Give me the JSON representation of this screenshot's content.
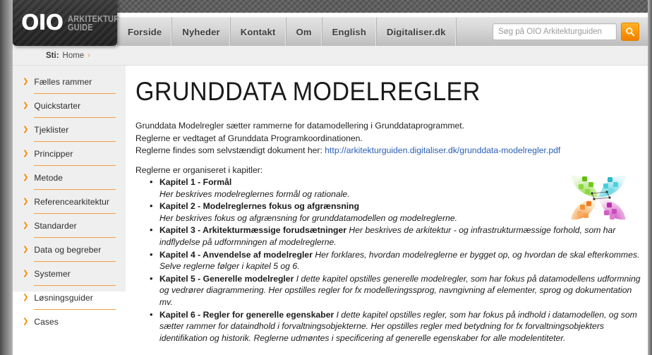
{
  "site": {
    "logo_main": "OIO",
    "logo_sub_line1": "ARKITEKTUR",
    "logo_sub_line2": "GUIDE",
    "accent_orange": "#f08c00",
    "link_blue": "#2b5fb5",
    "nav_bg": "#d5d5d5",
    "sidebar_bg": "#efefef"
  },
  "nav": {
    "items": [
      {
        "label": "Forside"
      },
      {
        "label": "Nyheder"
      },
      {
        "label": "Kontakt"
      },
      {
        "label": "Om"
      },
      {
        "label": "English"
      },
      {
        "label": "Digitaliser.dk"
      }
    ]
  },
  "search": {
    "placeholder": "Søg på OIO Arkitekturguiden",
    "value": "",
    "button_icon": "search-icon"
  },
  "breadcrumb": {
    "label": "Sti:",
    "home": "Home",
    "separator": "›"
  },
  "sidebar": {
    "items": [
      {
        "label": "Fælles rammer"
      },
      {
        "label": "Quickstarter"
      },
      {
        "label": "Tjeklister"
      },
      {
        "label": "Principper"
      },
      {
        "label": "Metode"
      },
      {
        "label": "Referencearkitektur"
      },
      {
        "label": "Standarder"
      },
      {
        "label": "Data og begreber"
      },
      {
        "label": "Systemer"
      },
      {
        "label": "Løsningsguider"
      },
      {
        "label": "Cases"
      }
    ]
  },
  "main": {
    "title": "GRUNDDATA MODELREGLER",
    "intro": {
      "line1": "Grunddata Modelregler sætter rammerne for datamodellering i Grunddataprogrammet.",
      "line2": "Reglerne er vedtaget af Grunddata Programkoordinationen.",
      "line3_prefix": "Reglerne findes som selvstændigt dokument her: ",
      "line3_link": "http://arkitekturguiden.digitaliser.dk/grunddata-modelregler.pdf",
      "line4": "Reglerne er organiseret i kapitler:"
    },
    "chapters": [
      {
        "title": "Kapitel 1 - Formål",
        "desc": "Her beskrives modelreglernes formål og rationale.",
        "inline": false
      },
      {
        "title": "Kapitel 2 - Modelreglernes fokus og afgrænsning",
        "desc": "Her beskrives fokus og afgrænsning for grunddatamodellen og modelreglerne.",
        "inline": false
      },
      {
        "title": "Kapitel 3 - Arkitekturmæssige forudsætninger",
        "desc": "Her beskrives de arkitektur - og infrastrukturmæssige forhold, som har indflydelse på udformningen af modelreglerne.",
        "inline": true
      },
      {
        "title": "Kapitel 4 - Anvendelse af modelregler",
        "desc": "Her forklares, hvordan modelreglerne er bygget op, og hvordan de skal efterkommes. Selve reglerne følger i kapitel 5 og 6.",
        "inline": true
      },
      {
        "title": "Kapitel 5 - Generelle modelregler",
        "desc": "I dette kapitel opstilles generelle modelregler, som har fokus på datamodellens udformning og vedrører diagrammering. Her opstilles regler for fx modelleringssprog, navngivning af elementer, sprog og dokumentation mv.",
        "inline": true
      },
      {
        "title": "Kapitel 6 - Regler for generelle egenskaber",
        "desc": "I dette kapitel opstilles regler, som har fokus på indhold i datamodellen, og som sætter rammer for dataindhold i forvaltningsobjekterne. Her opstilles regler med betydning for fx forvaltningsobjekters identifikation og historik. Reglerne udmøntes i specificering af generelle egenskaber for alle modelentiteter.",
        "inline": true
      }
    ],
    "graphic": {
      "name": "pinwheel-logo",
      "petal_colors": [
        "#7ed321",
        "#2ec7d8",
        "#f5a623",
        "#c838b8"
      ]
    }
  }
}
